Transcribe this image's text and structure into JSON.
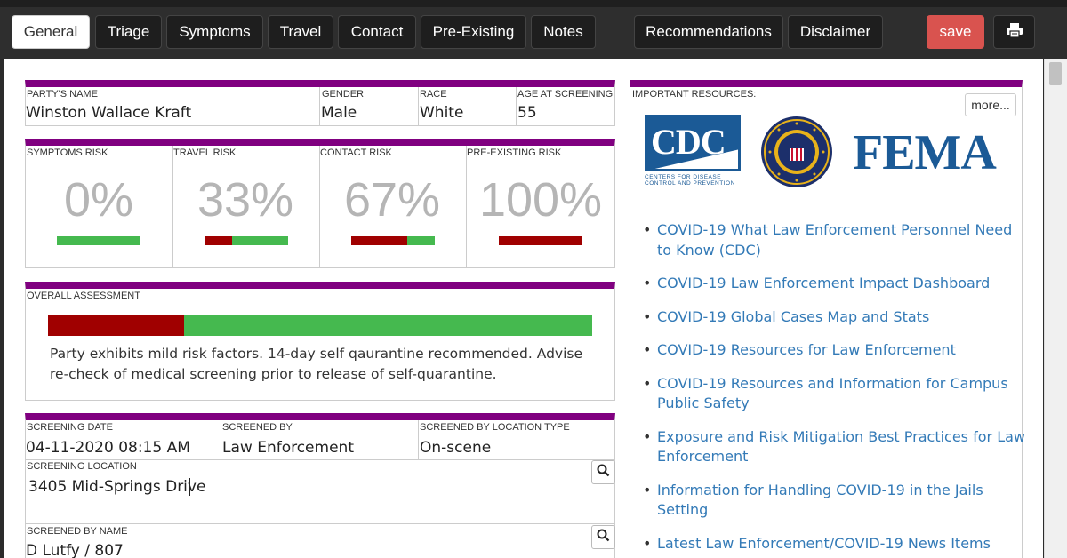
{
  "nav": {
    "tabs": [
      "General",
      "Triage",
      "Symptoms",
      "Travel",
      "Contact",
      "Pre-Existing",
      "Notes"
    ],
    "right_tabs": [
      "Recommendations",
      "Disclaimer"
    ],
    "save_label": "save",
    "active_tab": "General",
    "icons": {
      "print": "print-icon"
    }
  },
  "party": {
    "name_label": "PARTY'S NAME",
    "name": "Winston Wallace Kraft",
    "gender_label": "GENDER",
    "gender": "Male",
    "race_label": "RACE",
    "race": "White",
    "age_label": "AGE AT SCREENING",
    "age": "55"
  },
  "risks": [
    {
      "label": "SYMPTOMS RISK",
      "value": "0%",
      "fraction": 0.0
    },
    {
      "label": "TRAVEL RISK",
      "value": "33%",
      "fraction": 0.33
    },
    {
      "label": "CONTACT RISK",
      "value": "67%",
      "fraction": 0.67
    },
    {
      "label": "PRE-EXISTING RISK",
      "value": "100%",
      "fraction": 1.0
    }
  ],
  "assessment": {
    "label": "OVERALL ASSESSMENT",
    "fraction": 0.25,
    "text": "Party exhibits mild risk factors. 14-day self qaurantine recommended. Advise re-check of medical screening prior to release of self-quarantine."
  },
  "screening": {
    "date_label": "SCREENING DATE",
    "date": "04-11-2020 08:15 AM",
    "by_label": "SCREENED BY",
    "by": "Law Enforcement",
    "loc_type_label": "SCREENED BY LOCATION TYPE",
    "loc_type": "On-scene",
    "location_label": "SCREENING LOCATION",
    "location": "3405 Mid-Springs Drive",
    "name_label": "SCREENED BY NAME",
    "name": "D Lutfy / 807"
  },
  "resources": {
    "label": "IMPORTANT RESOURCES:",
    "more_label": "more...",
    "logos": {
      "cdc": "CDC",
      "cdc_sub1": "CENTERS FOR DISEASE",
      "cdc_sub2": "CONTROL AND PREVENTION",
      "fema": "FEMA",
      "fbi": "fbi-seal"
    },
    "links": [
      "COVID-19 What Law Enforcement Personnel Need to Know (CDC)",
      "COVID-19 Law Enforcement Impact Dashboard",
      "COVID-19 Global Cases Map and Stats",
      "COVID-19 Resources for Law Enforcement",
      "COVID-19 Resources and Information for Campus Public Safety",
      "Exposure and Risk Mitigation Best Practices for Law Enforcement",
      "Information for Handling COVID-19 in the Jails Setting",
      "Latest Law Enforcement/COVID-19 News Items"
    ]
  },
  "colors": {
    "accent": "#800080",
    "risk_red": "#a00000",
    "risk_green": "#45b94f",
    "save": "#d9534f",
    "link": "#337ab7"
  }
}
